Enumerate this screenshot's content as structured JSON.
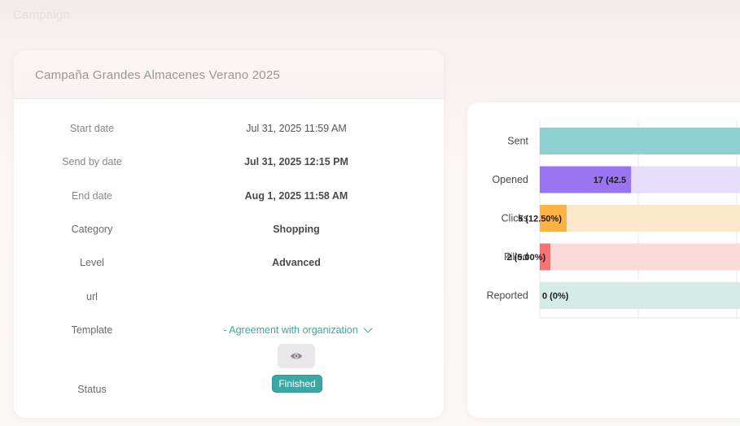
{
  "page": {
    "heading": "Campaign"
  },
  "card": {
    "title": "Campaña Grandes Almacenes Verano 2025",
    "rows": [
      {
        "label": "Start date",
        "value": "Jul 31, 2025 11:59 AM"
      },
      {
        "label": "Send by date",
        "value": "Jul 31, 2025 12:15 PM"
      },
      {
        "label": "End date",
        "value": "Aug 1, 2025 11:58 AM"
      },
      {
        "label": "Category",
        "value": "Shopping"
      },
      {
        "label": "Level",
        "value": "Advanced"
      },
      {
        "label": "url",
        "value": ""
      },
      {
        "label": "Template",
        "value": "- Agreement with organization"
      },
      {
        "label": "Status",
        "value": "Finished"
      }
    ]
  },
  "colors": {
    "accent": "#3fa896",
    "status_finished": "#3aa9a6"
  },
  "icons": {
    "preview": "eye-icon",
    "expand": "chevron-down-icon"
  },
  "chart_data": {
    "type": "bar",
    "orientation": "horizontal",
    "categories": [
      "Sent",
      "Opened",
      "Clicks",
      "Filled",
      "Reported"
    ],
    "labels": [
      "",
      "17 (42.5",
      "5 (12.50%)",
      "2 (5.00%)",
      "0 (0%)"
    ],
    "values": [
      40,
      17,
      5,
      2,
      0
    ],
    "percent": [
      100,
      42.5,
      12.5,
      5,
      0
    ],
    "bar_colors": [
      "#8ecfd2",
      "#9b74f2",
      "#fdb243",
      "#f47373",
      "#d4ebe6"
    ],
    "track_colors": [
      "#8ecfd2",
      "#e7ddfc",
      "#fde8cc",
      "#fddada",
      "#d4ebe6"
    ],
    "xlim": [
      0,
      40
    ],
    "grid": true
  }
}
